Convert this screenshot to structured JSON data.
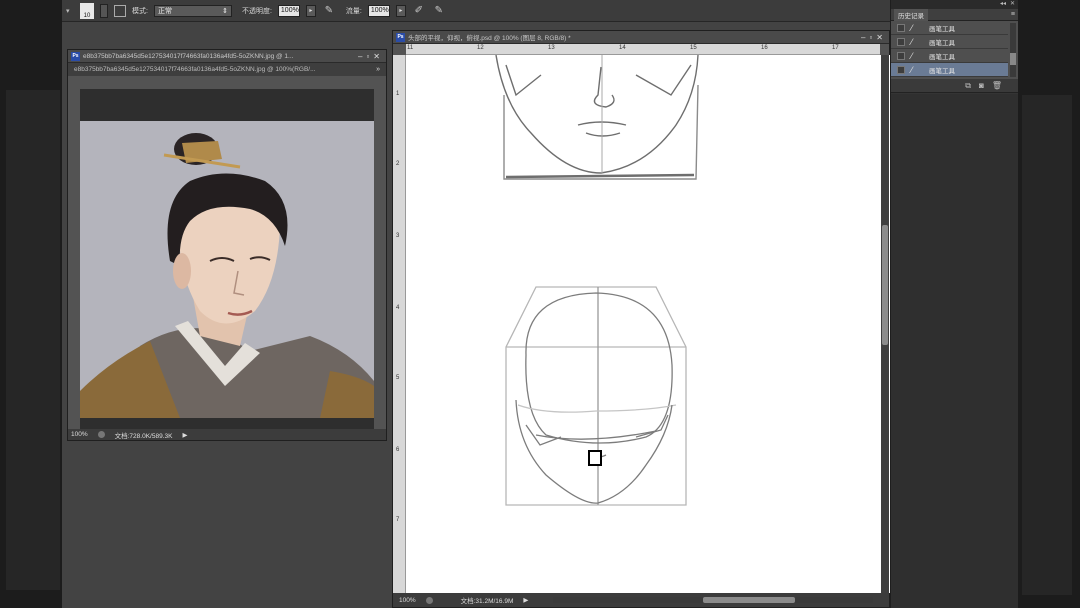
{
  "options_bar": {
    "brush_size": "10",
    "mode_label": "模式:",
    "mode_value": "正常",
    "opacity_label": "不透明度:",
    "opacity_value": "100%",
    "flow_label": "流量:",
    "flow_value": "100%"
  },
  "image_window": {
    "title": "e8b375bb7ba6345d5e127534017f74663fa0136a4fd5-5oZKNN.jpg @ 1...",
    "tab": "e8b375bb7ba6345d5e127534017f74663fa0136a4fd5-5oZKNN.jpg @ 100%(RGB/...",
    "zoom": "100%",
    "doc_info": "文档:728.0K/589.3K"
  },
  "doc_window": {
    "title": "头部的平视，仰视，俯视.psd @ 100% (图层 8, RGB/8) *",
    "ruler_top": [
      "11",
      "12",
      "13",
      "14",
      "15",
      "16",
      "17"
    ],
    "ruler_left": [
      "1",
      "2",
      "3",
      "4",
      "5",
      "6",
      "7"
    ],
    "zoom": "100%",
    "doc_info": "文档:31.2M/16.9M"
  },
  "history_panel": {
    "tab_label": "历史记录",
    "items": [
      "画笔工具",
      "画笔工具",
      "画笔工具",
      "画笔工具"
    ],
    "active_index": 3
  },
  "colors": {
    "ui_dark": "#2b2b2b",
    "panel": "#343434",
    "history_highlight": "#6a7b95",
    "ps_blue": "#2a4ca8"
  }
}
